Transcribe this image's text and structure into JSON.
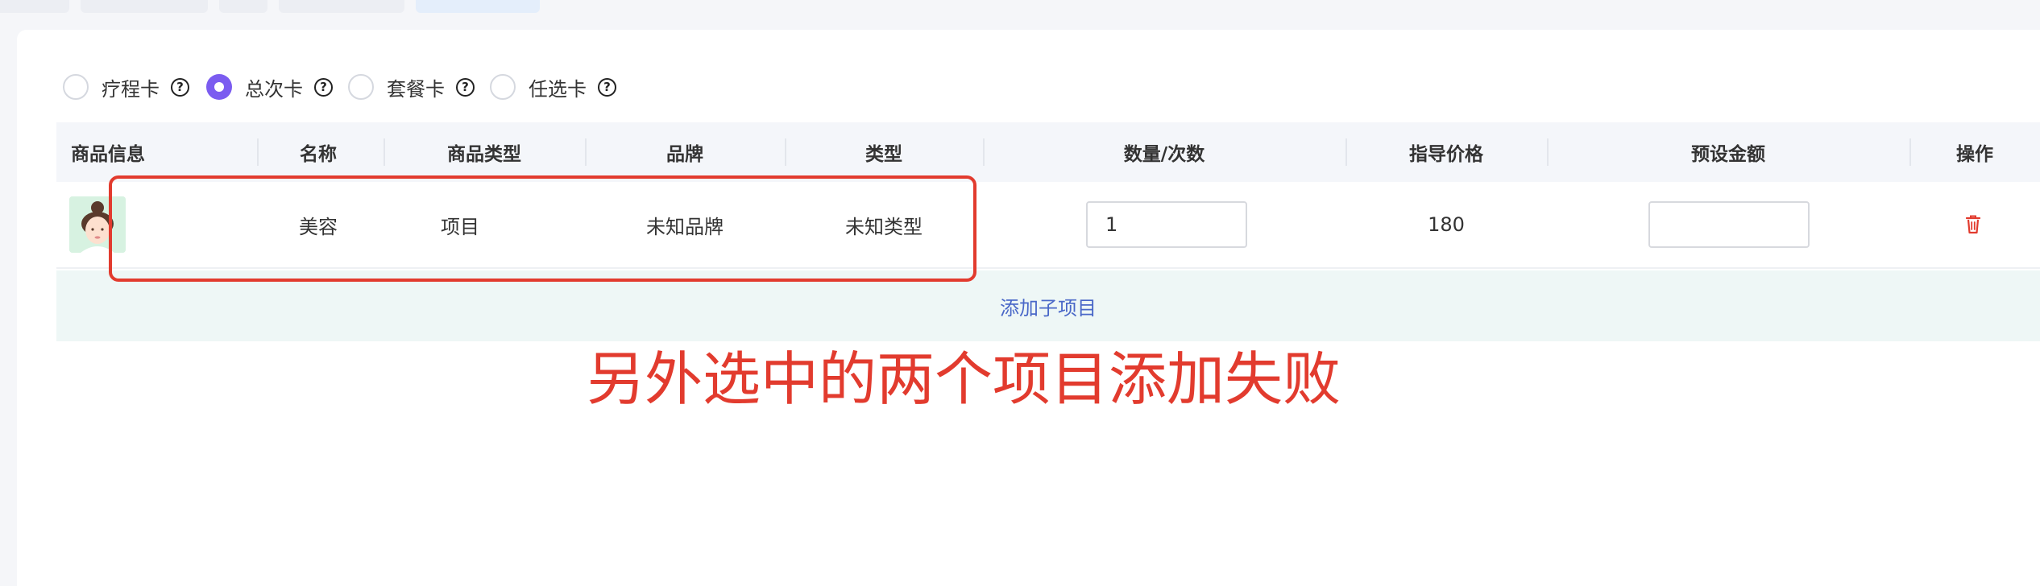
{
  "radio_group": {
    "options": [
      {
        "label": "疗程卡",
        "checked": false
      },
      {
        "label": "总次卡",
        "checked": true
      },
      {
        "label": "套餐卡",
        "checked": false
      },
      {
        "label": "任选卡",
        "checked": false
      }
    ],
    "help_glyph": "?",
    "accent_color": "#7b5cf0"
  },
  "table": {
    "headers": {
      "product_info": "商品信息",
      "name": "名称",
      "product_type": "商品类型",
      "brand": "品牌",
      "type": "类型",
      "quantity": "数量/次数",
      "guide_price": "指导价格",
      "preset_amount": "预设金额",
      "actions": "操作"
    },
    "rows": [
      {
        "image_icon": "avatar-thumbnail",
        "name": "美容",
        "product_type": "项目",
        "brand": "未知品牌",
        "type": "未知类型",
        "quantity": "1",
        "guide_price": "180",
        "preset_amount": "",
        "delete_icon": "trash-icon"
      }
    ]
  },
  "add_sub_item_label": "添加子项目",
  "annotation": {
    "text": "另外选中的两个项目添加失败",
    "color": "#e23b2e"
  }
}
